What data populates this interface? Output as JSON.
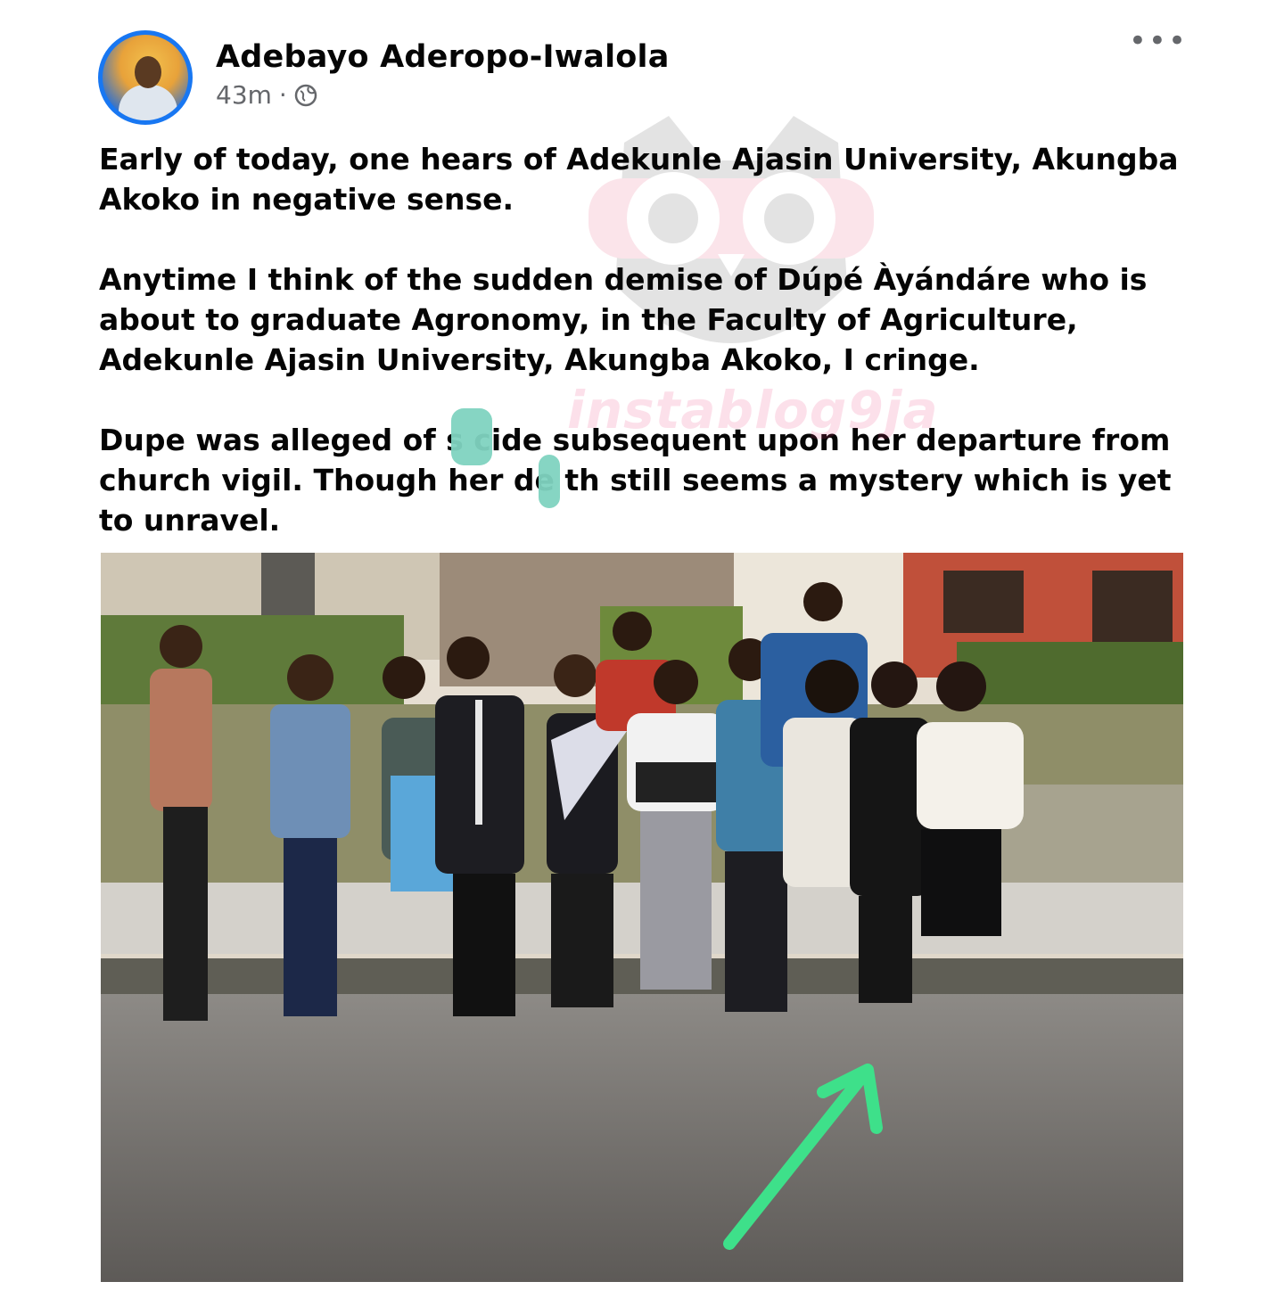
{
  "post": {
    "author": "Adebayo Aderopo-Iwalola",
    "timestamp": "43m",
    "separator": "·",
    "privacy_icon": "globe-icon",
    "more_label": "•••",
    "paragraphs": [
      "Early of today, one hears of Adekunle Ajasin University, Akungba Akoko in negative sense.",
      "Anytime I think of the sudden demise of Dúpé Àyándáre who is about to graduate Agronomy, in the Faculty of Agriculture, Adekunle Ajasin University, Akungba Akoko, I cringe.",
      "Dupe was alleged of s  cide subsequent upon her departure from church vigil. Though her de  th still seems a mystery which is yet to unravel."
    ]
  },
  "watermark": {
    "text": "instablog9ja"
  },
  "colors": {
    "accent": "#1877f2",
    "arrow": "#3ee08a",
    "redaction": "#7fd3c0"
  }
}
